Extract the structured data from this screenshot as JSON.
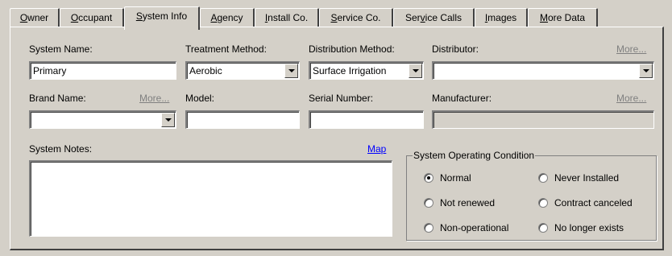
{
  "tabs": [
    {
      "pre": "",
      "ul": "O",
      "post": "wner"
    },
    {
      "pre": "",
      "ul": "O",
      "post": "ccupant"
    },
    {
      "pre": "",
      "ul": "S",
      "post": "ystem Info"
    },
    {
      "pre": "",
      "ul": "A",
      "post": "gency"
    },
    {
      "pre": "",
      "ul": "I",
      "post": "nstall Co."
    },
    {
      "pre": "",
      "ul": "S",
      "post": "ervice Co."
    },
    {
      "pre": "Ser",
      "ul": "v",
      "post": "ice Calls"
    },
    {
      "pre": "",
      "ul": "I",
      "post": "mages"
    },
    {
      "pre": "",
      "ul": "M",
      "post": "ore Data"
    }
  ],
  "active_tab": "System Info",
  "fields": {
    "system_name": {
      "label": "System Name:",
      "value": "Primary"
    },
    "treatment_method": {
      "label": "Treatment Method:",
      "value": "Aerobic"
    },
    "distribution_method": {
      "label": "Distribution Method:",
      "value": "Surface Irrigation"
    },
    "distributor": {
      "label": "Distributor:",
      "value": "",
      "more": "More..."
    },
    "brand_name": {
      "label": "Brand Name:",
      "value": "",
      "more": "More..."
    },
    "model": {
      "label": "Model:",
      "value": ""
    },
    "serial_number": {
      "label": "Serial Number:",
      "value": ""
    },
    "manufacturer": {
      "label": "Manufacturer:",
      "value": "",
      "more": "More..."
    },
    "system_notes": {
      "label": "System Notes:",
      "value": "",
      "link": "Map"
    }
  },
  "condition": {
    "title": "System Operating Condition",
    "options": [
      "Normal",
      "Never Installed",
      "Not renewed",
      "Contract canceled",
      "Non-operational",
      "No longer exists"
    ],
    "selected": "Normal"
  },
  "icons": {
    "dropdown": "chevron-down-icon",
    "radio": "radio-icon"
  }
}
